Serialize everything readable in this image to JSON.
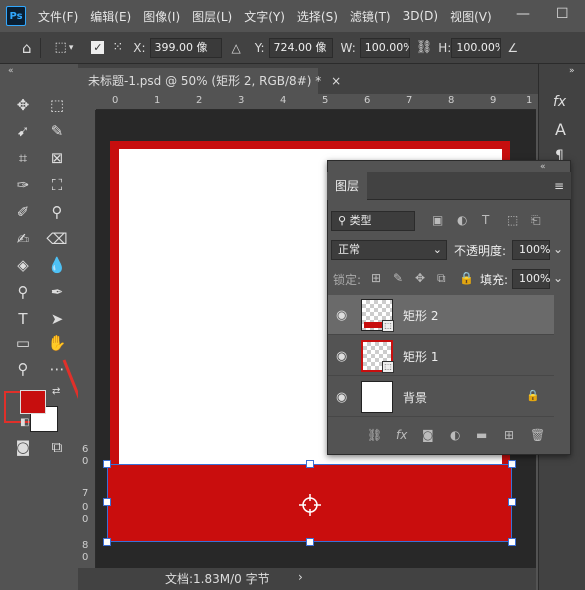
{
  "app": {
    "logo": "Ps"
  },
  "menu": [
    "文件(F)",
    "编辑(E)",
    "图像(I)",
    "图层(L)",
    "文字(Y)",
    "选择(S)",
    "滤镜(T)",
    "3D(D)",
    "视图(V)"
  ],
  "window_controls": {
    "minimize": "—",
    "maximize": "☐"
  },
  "options": {
    "x_label": "X:",
    "x_value": "399.00 像",
    "y_label": "Y:",
    "y_value": "724.00 像",
    "w_label": "W:",
    "w_value": "100.00%",
    "h_label": "H:",
    "h_value": "100.00%"
  },
  "document": {
    "tab_title": "未标题-1.psd @ 50% (矩形 2, RGB/8#) *",
    "close": "×"
  },
  "ruler_top_labels": [
    "0",
    "1",
    "2",
    "3",
    "4",
    "5",
    "6",
    "7",
    "8",
    "9",
    "1"
  ],
  "ruler_left_labels": [
    "6",
    "0",
    "7",
    "0",
    "0",
    "8",
    "0"
  ],
  "status": {
    "text": "文档:1.83M/0 字节",
    "arrow": "›"
  },
  "colors": {
    "foreground": "#c70e0e",
    "background": "#ffffff",
    "accent": "#3b6fd6",
    "highlight": "#e0302a"
  },
  "layers_panel": {
    "tab": "图层",
    "filter_placeholder": "类型",
    "blend_mode": "正常",
    "opacity_label": "不透明度:",
    "opacity_value": "100%",
    "lock_label": "锁定:",
    "fill_label": "填充:",
    "fill_value": "100%",
    "layers": [
      {
        "name": "矩形 2",
        "selected": true,
        "thumb": "rect-red-bottom"
      },
      {
        "name": "矩形 1",
        "selected": false,
        "thumb": "rect-red-border"
      },
      {
        "name": "背景",
        "selected": false,
        "thumb": "white",
        "locked": true
      }
    ]
  },
  "right_strip": {
    "fx": "fx",
    "A": "A"
  }
}
